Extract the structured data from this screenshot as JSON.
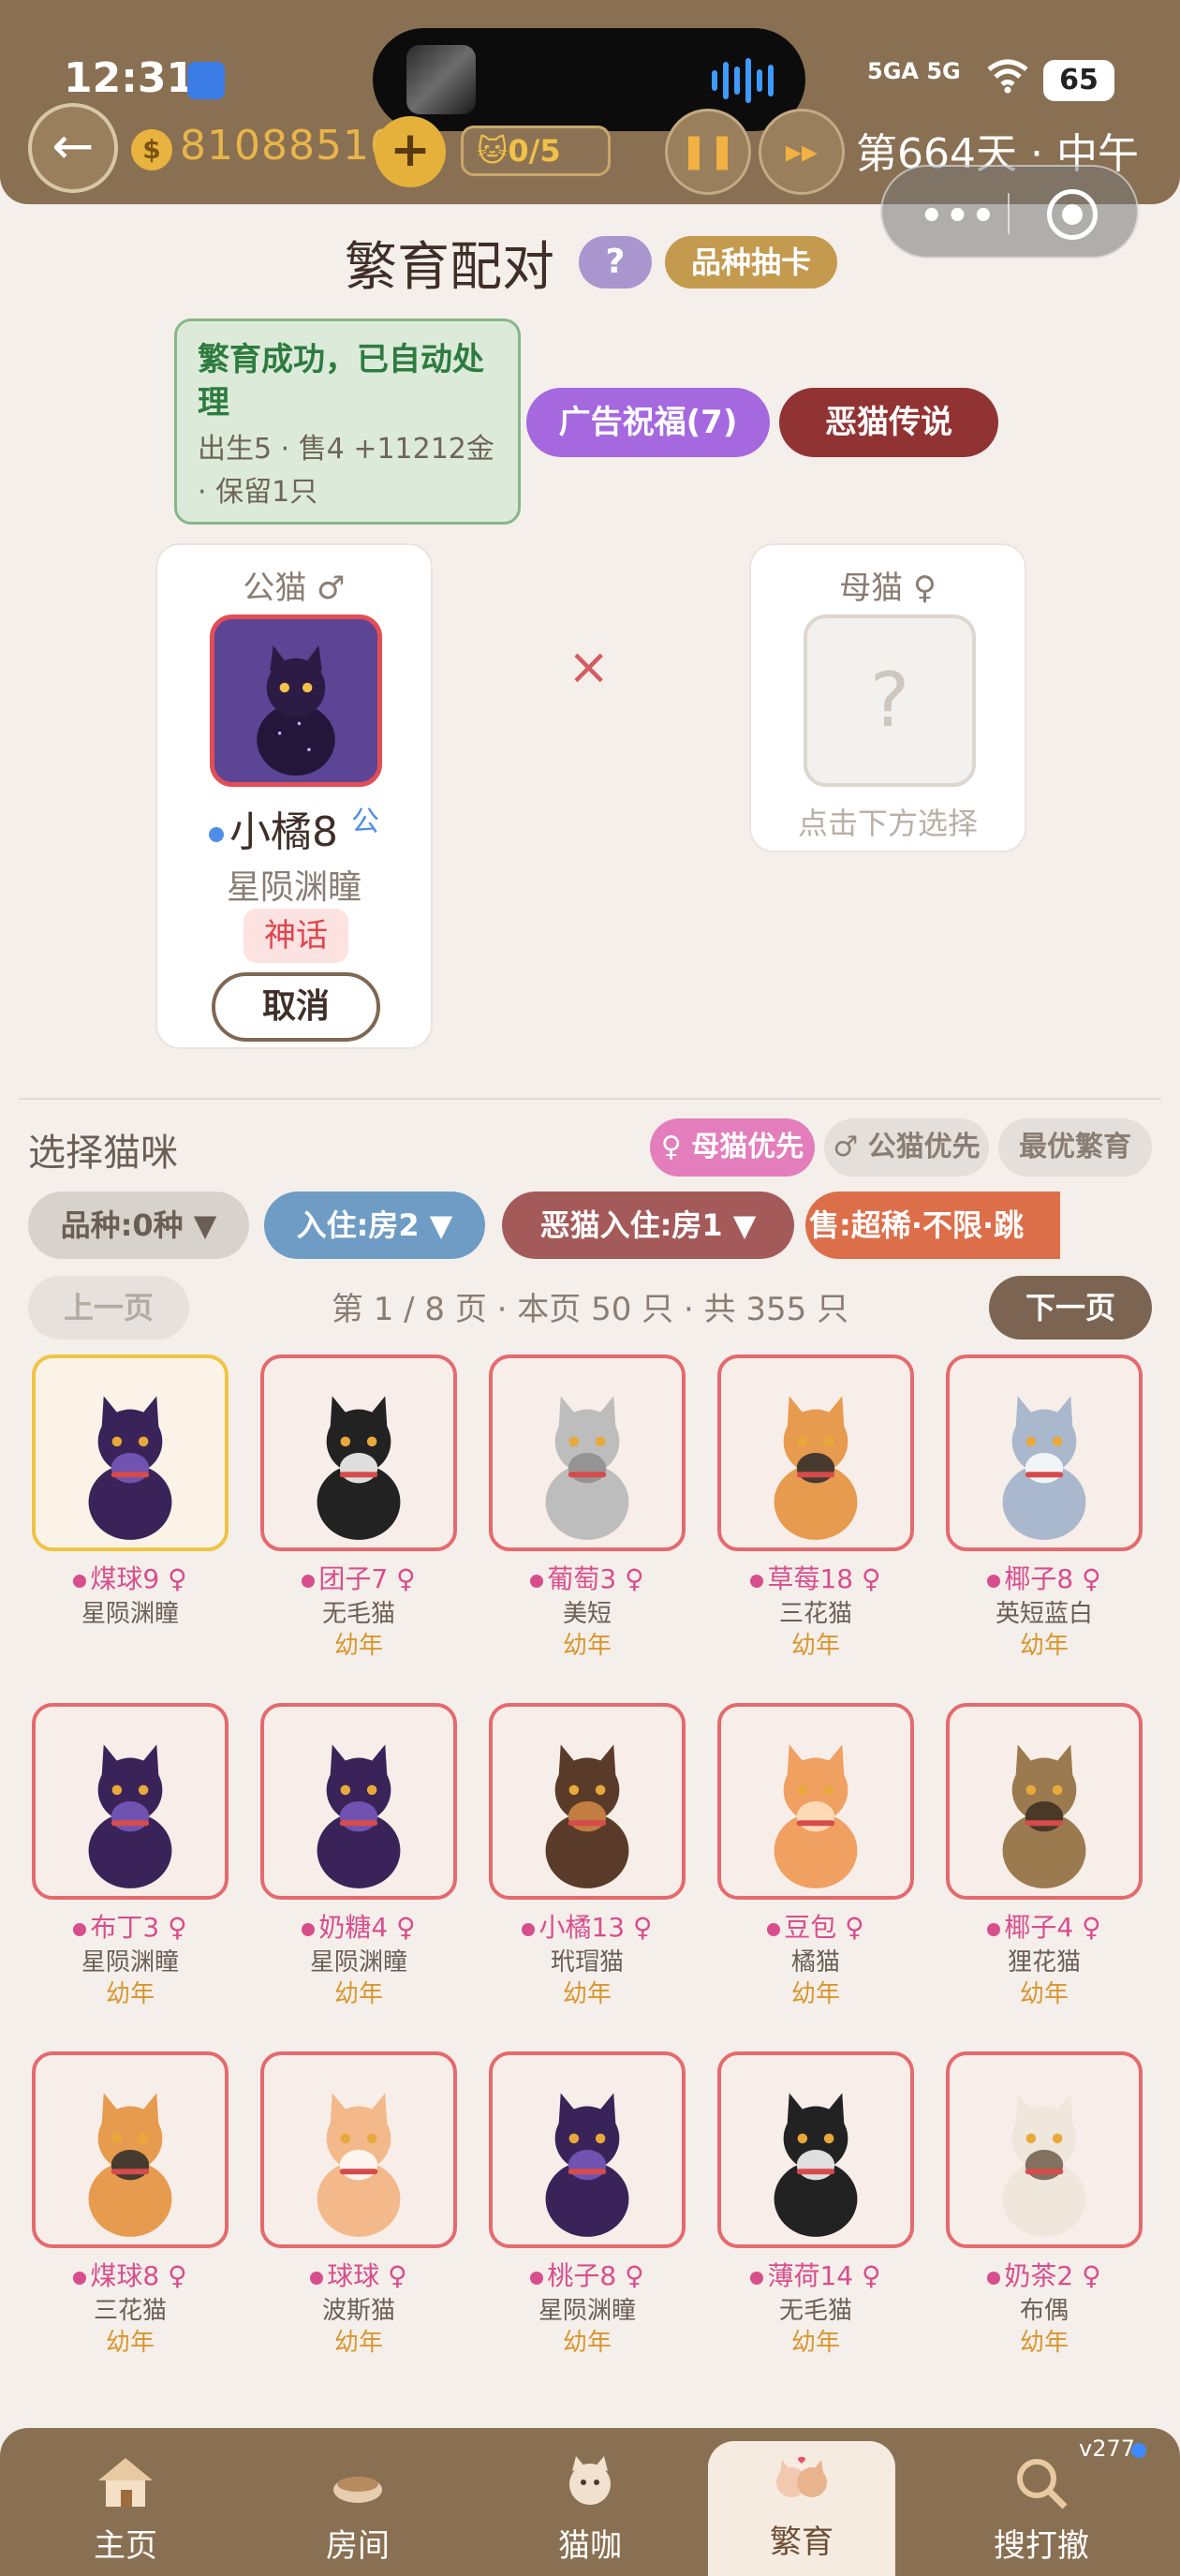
{
  "status_bar": {
    "time": "12:31",
    "signal": "5GA 5G",
    "battery": "65"
  },
  "header": {
    "coins": "81088510",
    "plus_label": "+",
    "cat_count": "0/5",
    "pause_label": "❚❚",
    "fast_forward_label": "▸▸",
    "day_label": "第664天 · 中午"
  },
  "page": {
    "title": "繁育配对",
    "help_label": "?",
    "gacha_label": "品种抽卡",
    "result_title": "繁育成功，已自动处理",
    "result_detail": "出生5 · 售4 +11212金 · 保留1只",
    "ad_label": "广告祝福(7)",
    "legend_label": "恶猫传说"
  },
  "pair": {
    "male_label": "公猫 ♂",
    "male_name": "小橘8",
    "male_gender": "公",
    "male_breed": "星陨渊瞳",
    "male_rarity": "神话",
    "cancel_label": "取消",
    "times": "×",
    "female_label": "母猫 ♀",
    "female_placeholder": "?",
    "female_hint": "点击下方选择"
  },
  "selection": {
    "title": "选择猫咪",
    "priority_female": "♀ 母猫优先",
    "priority_male": "♂ 公猫优先",
    "priority_best": "最优繁育",
    "filter_breed": "品种:0种 ▼",
    "filter_room": "入住:房2 ▼",
    "filter_evil": "恶猫入住:房1 ▼",
    "filter_sell": "售:超稀·不限·跳",
    "prev_label": "上一页",
    "page_info": "第 1 / 8 页 · 本页 50 只 · 共 355 只",
    "next_label": "下一页"
  },
  "cats": [
    {
      "name": "煤球9 ♀",
      "breed": "星陨渊瞳",
      "age": "",
      "selected": true,
      "color": "#3a2358",
      "accent": "#7a5bc1"
    },
    {
      "name": "团子7 ♀",
      "breed": "无毛猫",
      "age": "幼年",
      "color": "#222",
      "accent": "#ffffff"
    },
    {
      "name": "葡萄3 ♀",
      "breed": "美短",
      "age": "幼年",
      "color": "#bdbdbd",
      "accent": "#8d8d8d"
    },
    {
      "name": "草莓18 ♀",
      "breed": "三花猫",
      "age": "幼年",
      "color": "#e79b4f",
      "accent": "#2a2a2a"
    },
    {
      "name": "椰子8 ♀",
      "breed": "英短蓝白",
      "age": "幼年",
      "color": "#a9b8cc",
      "accent": "#ffffff"
    },
    {
      "name": "布丁3 ♀",
      "breed": "星陨渊瞳",
      "age": "幼年",
      "color": "#3a2358",
      "accent": "#7a5bc1"
    },
    {
      "name": "奶糖4 ♀",
      "breed": "星陨渊瞳",
      "age": "幼年",
      "color": "#3a2358",
      "accent": "#7a5bc1"
    },
    {
      "name": "小橘13 ♀",
      "breed": "玳瑁猫",
      "age": "幼年",
      "color": "#5a3b2a",
      "accent": "#d58a45"
    },
    {
      "name": "豆包 ♀",
      "breed": "橘猫",
      "age": "幼年",
      "color": "#f0a060",
      "accent": "#ffe4c4"
    },
    {
      "name": "椰子4 ♀",
      "breed": "狸花猫",
      "age": "幼年",
      "color": "#9b7a50",
      "accent": "#3c2e1e"
    },
    {
      "name": "煤球8 ♀",
      "breed": "三花猫",
      "age": "幼年",
      "color": "#e79b4f",
      "accent": "#2a2a2a"
    },
    {
      "name": "球球 ♀",
      "breed": "波斯猫",
      "age": "幼年",
      "color": "#f3b98a",
      "accent": "#ffffff"
    },
    {
      "name": "桃子8 ♀",
      "breed": "星陨渊瞳",
      "age": "幼年",
      "color": "#3a2358",
      "accent": "#7a5bc1"
    },
    {
      "name": "薄荷14 ♀",
      "breed": "无毛猫",
      "age": "幼年",
      "color": "#222",
      "accent": "#ffffff"
    },
    {
      "name": "奶茶2 ♀",
      "breed": "布偶",
      "age": "幼年",
      "color": "#efe6dc",
      "accent": "#6f5a4a"
    }
  ],
  "nav": {
    "items": [
      {
        "label": "主页",
        "icon": "house-icon"
      },
      {
        "label": "房间",
        "icon": "bowl-icon"
      },
      {
        "label": "猫咖",
        "icon": "cat-cup-icon"
      },
      {
        "label": "繁育",
        "icon": "cat-couple-icon",
        "active": true
      },
      {
        "label": "搜打撤",
        "icon": "magnifier-icon"
      }
    ],
    "version": "v277"
  }
}
